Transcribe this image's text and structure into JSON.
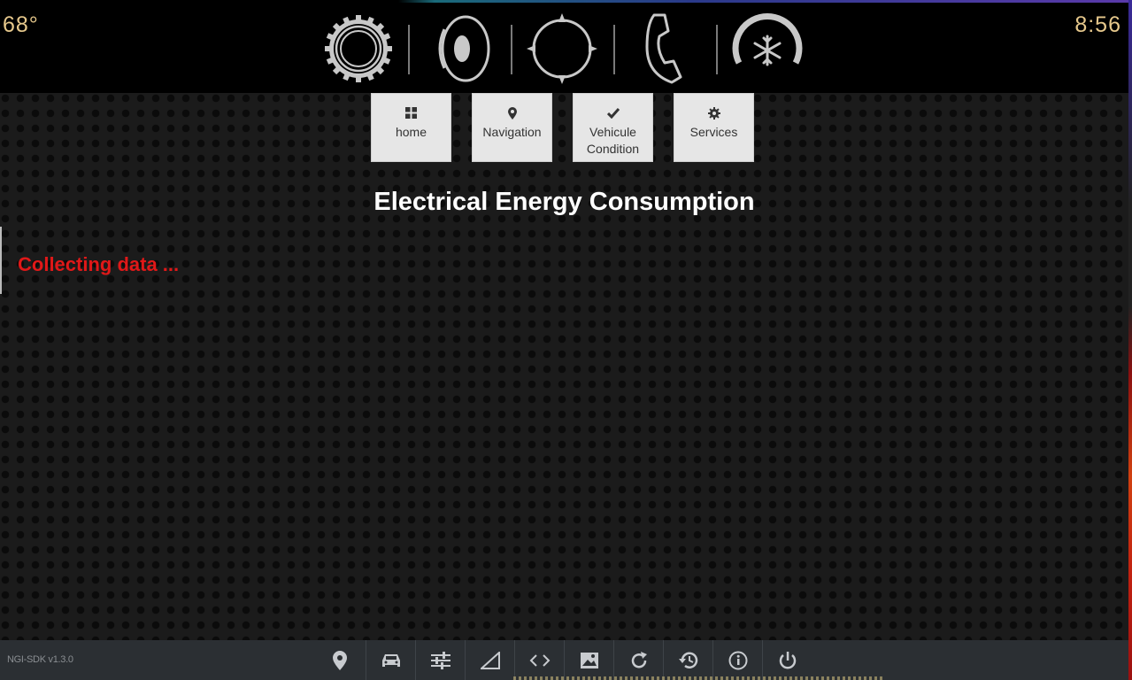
{
  "status_bar": {
    "temperature": "68°",
    "time": "8:56"
  },
  "app_icons": [
    "settings-dial-icon",
    "audio-speaker-icon",
    "navigation-compass-icon",
    "phone-icon",
    "climate-snowflake-icon"
  ],
  "nav": {
    "home": "home",
    "navigation": "Navigation",
    "vehicle_condition_line1": "Vehicule",
    "vehicle_condition_line2": "Condition",
    "services": "Services"
  },
  "main": {
    "title": "Electrical Energy Consumption",
    "status": "Collecting data ..."
  },
  "toolbar": {
    "version": "NGI-SDK v1.3.0",
    "buttons": [
      "location-pin-icon",
      "car-icon",
      "sliders-icon",
      "signal-icon",
      "code-icon",
      "image-icon",
      "refresh-icon",
      "history-icon",
      "info-icon",
      "power-icon"
    ]
  },
  "colors": {
    "accent_gold": "#e6c88c",
    "status_red": "#e01818",
    "tile_bg": "#e6e6e6",
    "toolbar_bg": "#2b2f33"
  }
}
